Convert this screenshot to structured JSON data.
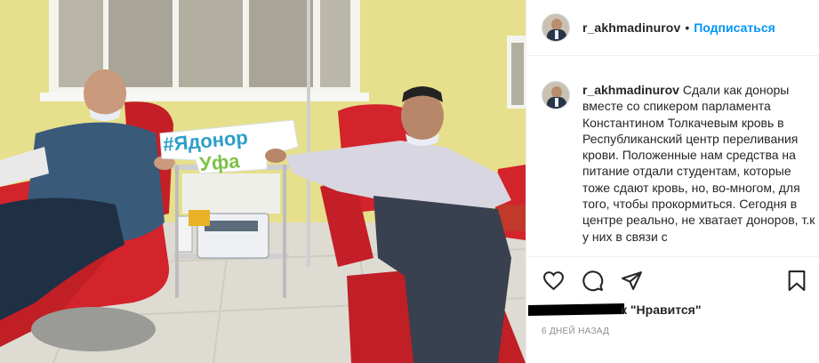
{
  "post": {
    "username": "r_akhmadinurov",
    "separator": "•",
    "follow_label": "Подписаться",
    "caption_username": "r_akhmadinurov",
    "caption_text": "Сдали как доноры вместе со спикером парламента Константином Толкачевым кровь в Республиканский центр переливания крови. Положенные нам средства на питание отдали студентам, которые тоже сдают кровь, но, во-многом, для того, чтобы прокормиться. Сегодня в центре реально, не хватает доноров, т.к у них в связи с",
    "likes_text": "к \"Нравится\"",
    "date_text": "6 ДНЕЙ НАЗАД"
  },
  "photo": {
    "sign_line1": "#Ядонор",
    "sign_line2": "Уфа"
  },
  "icons": {
    "like": "heart-icon",
    "comment": "comment-icon",
    "share": "paper-plane-icon",
    "save": "bookmark-icon"
  },
  "colors": {
    "accent": "#0095f6",
    "text": "#262626",
    "muted": "#8e8e8e",
    "border": "#efefef",
    "chair_red": "#d3232b",
    "wall_yellow": "#e6df8c"
  }
}
